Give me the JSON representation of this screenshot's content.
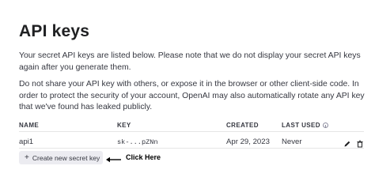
{
  "page": {
    "title": "API keys",
    "paragraph1": "Your secret API keys are listed below. Please note that we do not display your secret API keys again after you generate them.",
    "paragraph2": "Do not share your API key with others, or expose it in the browser or other client-side code. In order to protect the security of your account, OpenAI may also automatically rotate any API key that we've found has leaked publicly."
  },
  "table": {
    "columns": [
      "NAME",
      "KEY",
      "CREATED",
      "LAST USED"
    ],
    "rows": [
      {
        "name": "api1",
        "key": "sk-...pZNn",
        "created": "Apr 29, 2023",
        "last_used": "Never"
      }
    ]
  },
  "icons": {
    "last_used_info": "info-icon",
    "row_edit": "pencil-icon",
    "row_delete": "trash-icon",
    "create": "plus-icon",
    "annotation": "arrow-left-icon"
  },
  "actions": {
    "create_label": "Create new secret key",
    "create_plus": "+"
  },
  "annotation": {
    "text": "Click Here"
  }
}
